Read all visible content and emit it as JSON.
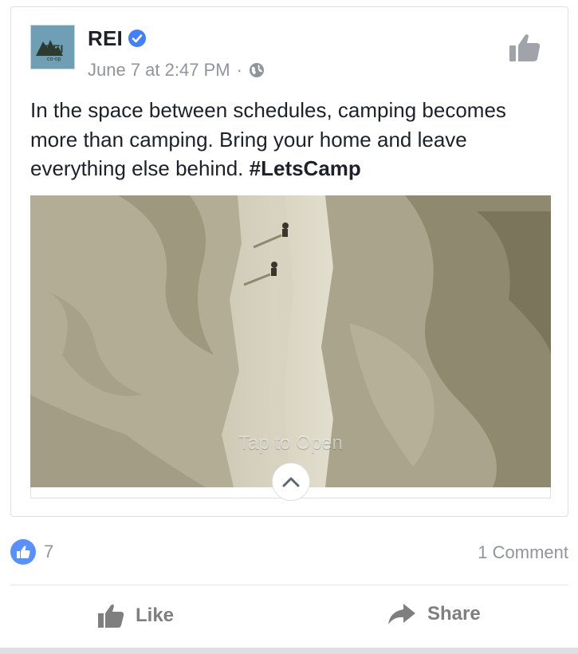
{
  "post": {
    "page_name": "REI",
    "logo_text_main": "REI",
    "logo_text_sub": "co-op",
    "timestamp": "June 7 at 2:47 PM",
    "separator": "·",
    "text_body": "In the space between schedules, camping becomes more than camping. Bring your home and leave everything else behind.",
    "hashtag": "#LetsCamp"
  },
  "media": {
    "overlay_text": "Tap to Open"
  },
  "stats": {
    "like_count": "7",
    "comment_count": "1 Comment"
  },
  "actions": {
    "like_label": "Like",
    "share_label": "Share"
  },
  "icons": {
    "verified": "verified-badge-icon",
    "privacy": "globe-icon",
    "save": "thumbs-up-icon",
    "reaction": "like-reaction-icon",
    "expand": "chevron-up-icon",
    "share": "share-arrow-icon"
  },
  "colors": {
    "facebook_blue": "#5890ff",
    "verified_blue": "#4080ff",
    "text_primary": "#1d2129",
    "text_secondary": "#90949c",
    "logo_bg": "#6f9fb5"
  }
}
